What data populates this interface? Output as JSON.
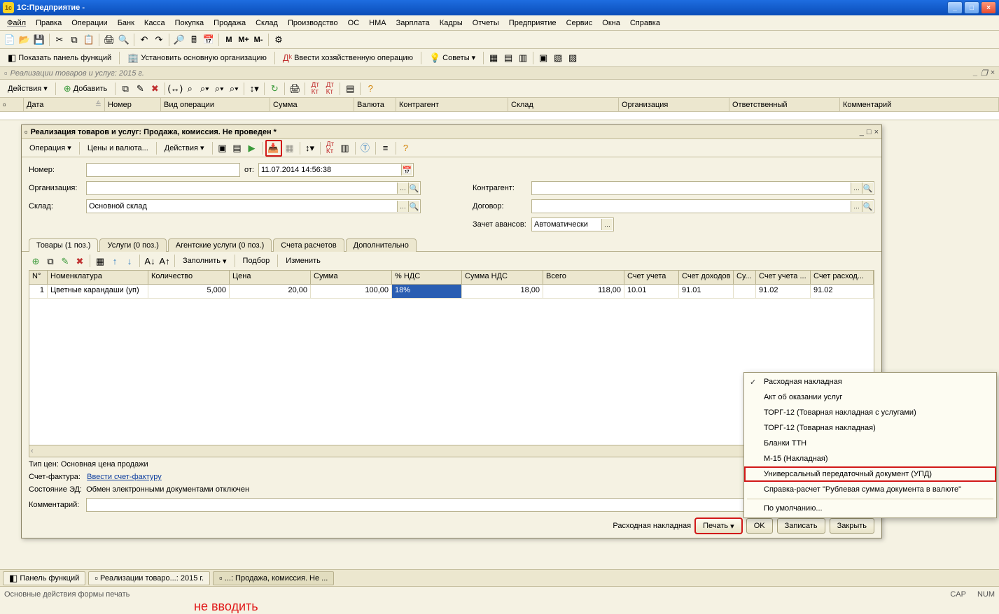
{
  "app": {
    "title": "1С:Предприятие -",
    "logo": "1c"
  },
  "menu": [
    "Файл",
    "Правка",
    "Операции",
    "Банк",
    "Касса",
    "Покупка",
    "Продажа",
    "Склад",
    "Производство",
    "ОС",
    "НМА",
    "Зарплата",
    "Кадры",
    "Отчеты",
    "Предприятие",
    "Сервис",
    "Окна",
    "Справка"
  ],
  "toolbar2": {
    "show_panel": "Показать панель функций",
    "set_org": "Установить основную организацию",
    "enter_op": "Ввести хозяйственную операцию",
    "tips": "Советы"
  },
  "sub_title": "Реализации товаров и услуг: 2015 г.",
  "actions": {
    "label": "Действия",
    "add": "Добавить"
  },
  "list_columns": [
    "",
    "Дата",
    "Номер",
    "Вид операции",
    "Сумма",
    "Валюта",
    "Контрагент",
    "Склад",
    "Организация",
    "Ответственный",
    "Комментарий"
  ],
  "doc": {
    "title": "Реализация товаров и услуг: Продажа, комиссия. Не проведен *",
    "tb": {
      "operation": "Операция",
      "prices": "Цены и валюта...",
      "actions": "Действия"
    },
    "form": {
      "number_lbl": "Номер:",
      "from_lbl": "от:",
      "date": "11.07.2014 14:56:38",
      "org_lbl": "Организация:",
      "warehouse_lbl": "Склад:",
      "warehouse": "Основной склад",
      "contr_lbl": "Контрагент:",
      "contract_lbl": "Договор:",
      "advance_lbl": "Зачет авансов:",
      "advance": "Автоматически"
    },
    "tabs": [
      "Товары (1 поз.)",
      "Услуги (0 поз.)",
      "Агентские услуги (0 поз.)",
      "Счета расчетов",
      "Дополнительно"
    ],
    "tab_tb": {
      "fill": "Заполнить",
      "select": "Подбор",
      "change": "Изменить"
    },
    "grid_cols": [
      "N°",
      "Номенклатура",
      "Количество",
      "Цена",
      "Сумма",
      "% НДС",
      "Сумма НДС",
      "Всего",
      "Счет учета",
      "Счет доходов",
      "Су...",
      "Счет учета ...",
      "Счет расход..."
    ],
    "grid_row": {
      "n": "1",
      "nom": "Цветные карандаши (уп)",
      "qty": "5,000",
      "price": "20,00",
      "sum": "100,00",
      "vat": "18%",
      "vat_sum": "18,00",
      "total": "118,00",
      "acc": "10.01",
      "acc_income": "91.01",
      "su": "",
      "acc_u": "91.02",
      "acc_exp": "91.02"
    },
    "footer": {
      "price_type": "Тип цен: Основная цена продажи",
      "sf_lbl": "Счет-фактура:",
      "sf_link": "Ввести счет-фактуру",
      "red_note": "не вводить",
      "ed_lbl": "Состояние ЭД:",
      "ed_txt": "Обмен электронными документами отключен",
      "comment_lbl": "Комментарий:"
    },
    "bottom": {
      "default_print": "Расходная накладная",
      "print": "Печать",
      "ok": "OK",
      "save": "Записать",
      "close": "Закрыть"
    }
  },
  "print_menu": [
    {
      "label": "Расходная накладная",
      "checked": true
    },
    {
      "label": "Акт об оказании услуг"
    },
    {
      "label": "ТОРГ-12 (Товарная накладная с услугами)"
    },
    {
      "label": "ТОРГ-12 (Товарная накладная)"
    },
    {
      "label": "Бланки ТТН"
    },
    {
      "label": "М-15 (Накладная)"
    },
    {
      "label": "Универсальный передаточный документ (УПД)",
      "hl": true
    },
    {
      "label": "Справка-расчет \"Рублевая сумма документа в валюте\""
    },
    {
      "sep": true
    },
    {
      "label": "По умолчанию..."
    }
  ],
  "taskbar": {
    "panel": "Панель функций",
    "b1": "Реализации товаро...: 2015 г.",
    "b2": "...: Продажа, комиссия. Не ..."
  },
  "status": {
    "left": "Основные действия формы печать",
    "cap": "CAP",
    "num": "NUM"
  }
}
